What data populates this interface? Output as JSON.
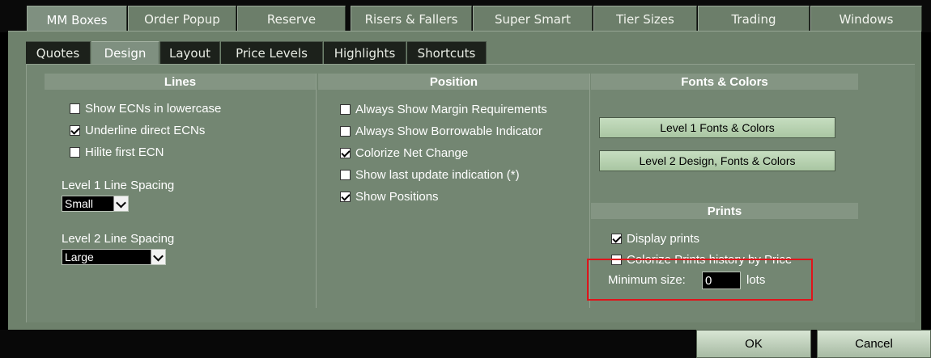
{
  "top_tabs": [
    "MM Boxes",
    "Order Popup",
    "Reserve",
    "Risers & Fallers",
    "Super Smart",
    "Tier Sizes",
    "Trading",
    "Windows"
  ],
  "sub_tabs": [
    "Quotes",
    "Design",
    "Layout",
    "Price Levels",
    "Highlights",
    "Shortcuts"
  ],
  "columns": {
    "lines": {
      "header": "Lines",
      "options": [
        {
          "label": "Show ECNs in lowercase",
          "checked": false
        },
        {
          "label": "Underline direct ECNs",
          "checked": true
        },
        {
          "label": "Hilite first ECN",
          "checked": false
        }
      ],
      "level1_label": "Level 1 Line Spacing",
      "level1_value": "Small",
      "level2_label": "Level 2 Line Spacing",
      "level2_value": "Large"
    },
    "position": {
      "header": "Position",
      "options": [
        {
          "label": "Always Show Margin Requirements",
          "checked": false
        },
        {
          "label": "Always Show Borrowable Indicator",
          "checked": false
        },
        {
          "label": "Colorize Net Change",
          "checked": true
        },
        {
          "label": "Show last update indication (*)",
          "checked": false
        },
        {
          "label": "Show Positions",
          "checked": true
        }
      ]
    },
    "fonts": {
      "header": "Fonts & Colors",
      "button1": "Level 1 Fonts & Colors",
      "button2": "Level 2 Design, Fonts & Colors"
    },
    "prints": {
      "header": "Prints",
      "options": [
        {
          "label": "Display prints",
          "checked": true
        },
        {
          "label": "Colorize Prints history by Price",
          "checked": false
        }
      ],
      "min_size_label": "Minimum size:",
      "min_size_value": "0",
      "min_size_unit": "lots"
    }
  },
  "footer": {
    "ok": "OK",
    "cancel": "Cancel"
  },
  "colors": {
    "panel": "#738672",
    "highlight": "#e0141b",
    "button": "#b8d3b1"
  }
}
